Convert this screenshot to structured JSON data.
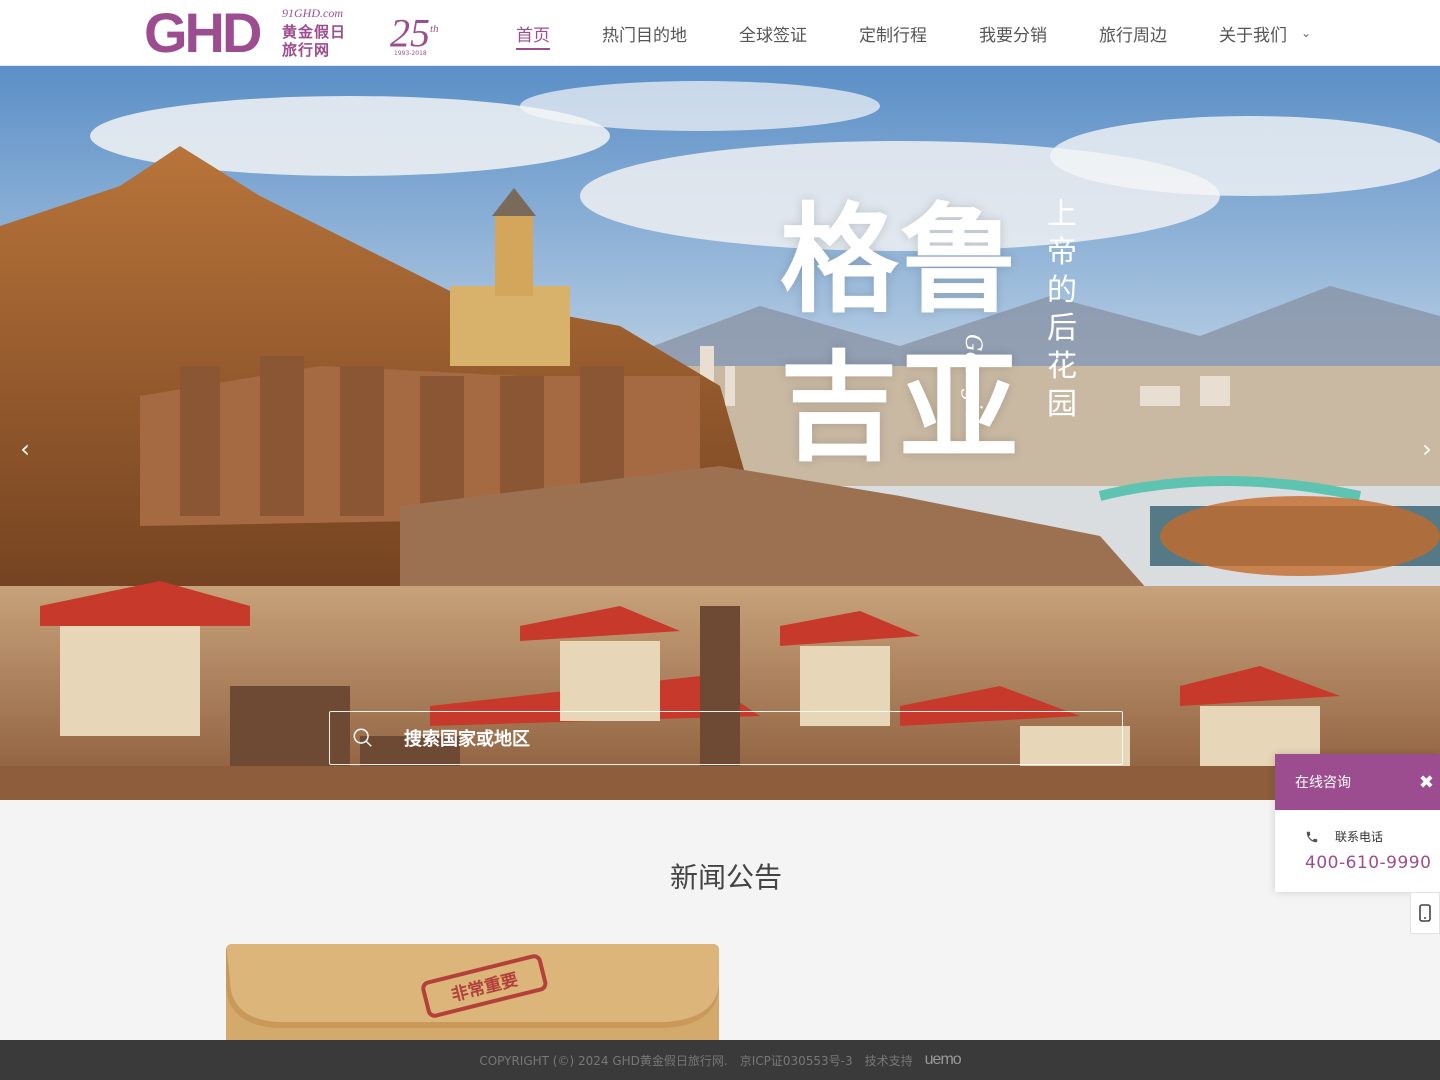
{
  "brand": {
    "logo_letters": "GHD",
    "logo_url": "91GHD.com",
    "logo_cn_line1": "黄金假日",
    "logo_cn_line2": "旅行网",
    "anniversary": "25",
    "anniversary_suffix": "th",
    "anniversary_years": "1993-2018",
    "color": "#9c4d8f"
  },
  "nav": {
    "items": [
      {
        "label": "首页",
        "active": true
      },
      {
        "label": "热门目的地"
      },
      {
        "label": "全球签证"
      },
      {
        "label": "定制行程"
      },
      {
        "label": "我要分销"
      },
      {
        "label": "旅行周边"
      },
      {
        "label": "关于我们",
        "has_dropdown": true
      }
    ]
  },
  "hero": {
    "title_line1": "格鲁",
    "title_line2": "吉亚",
    "subtitle_vertical": "上帝的后花园",
    "subtitle_en": "Georgia",
    "prev_icon": "chevron-left-icon",
    "next_icon": "chevron-right-icon",
    "search_placeholder": "搜索国家或地区",
    "search_icon": "search-icon"
  },
  "news": {
    "title": "新闻公告",
    "card_stamp": "非常重要"
  },
  "consult": {
    "title": "在线咨询",
    "close_icon": "close-icon",
    "phone_label": "联系电话",
    "phone": "400-610-9990",
    "mobile_icon": "mobile-phone-icon"
  },
  "footer": {
    "copyright": "COPYRIGHT (©) 2024 GHD黄金假日旅行网.",
    "icp": "京ICP证030553号-3",
    "tech_support": "技术支持",
    "tech_logo": "uemo"
  }
}
